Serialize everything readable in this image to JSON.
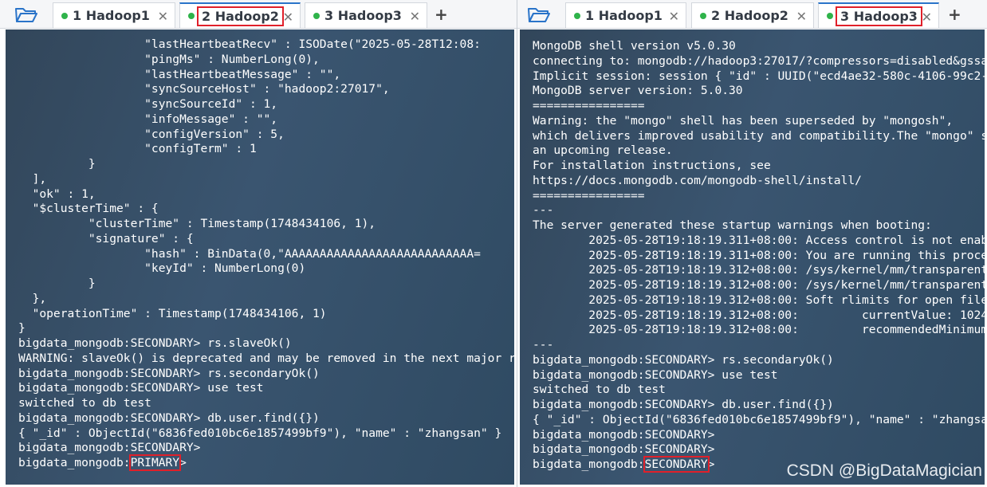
{
  "left": {
    "tabs": [
      {
        "label": "1 Hadoop1",
        "active": false,
        "highlighted": false
      },
      {
        "label": "2 Hadoop2",
        "active": true,
        "highlighted": true
      },
      {
        "label": "3 Hadoop3",
        "active": false,
        "highlighted": false
      }
    ],
    "lines": [
      "                  \"lastHeartbeatRecv\" : ISODate(\"2025-05-28T12:08:",
      "                  \"pingMs\" : NumberLong(0),",
      "                  \"lastHeartbeatMessage\" : \"\",",
      "                  \"syncSourceHost\" : \"hadoop2:27017\",",
      "                  \"syncSourceId\" : 1,",
      "                  \"infoMessage\" : \"\",",
      "                  \"configVersion\" : 5,",
      "                  \"configTerm\" : 1",
      "          }",
      "  ],",
      "  \"ok\" : 1,",
      "  \"$clusterTime\" : {",
      "          \"clusterTime\" : Timestamp(1748434106, 1),",
      "          \"signature\" : {",
      "                  \"hash\" : BinData(0,\"AAAAAAAAAAAAAAAAAAAAAAAAAAA=",
      "                  \"keyId\" : NumberLong(0)",
      "          }",
      "  },",
      "  \"operationTime\" : Timestamp(1748434106, 1)",
      "}",
      "bigdata_mongodb:SECONDARY> rs.slaveOk()",
      "WARNING: slaveOk() is deprecated and may be removed in the next major re",
      "bigdata_mongodb:SECONDARY> rs.secondaryOk()",
      "bigdata_mongodb:SECONDARY> use test",
      "switched to db test",
      "bigdata_mongodb:SECONDARY> db.user.find({})",
      "{ \"_id\" : ObjectId(\"6836fed010bc6e1857499bf9\"), \"name\" : \"zhangsan\" }",
      "bigdata_mongodb:SECONDARY>"
    ],
    "last_prefix": "bigdata_mongodb:",
    "last_state": "PRIMARY",
    "last_suffix": ">"
  },
  "right": {
    "tabs": [
      {
        "label": "1 Hadoop1",
        "active": false,
        "highlighted": false
      },
      {
        "label": "2 Hadoop2",
        "active": false,
        "highlighted": false
      },
      {
        "label": "3 Hadoop3",
        "active": true,
        "highlighted": true
      }
    ],
    "lines": [
      "MongoDB shell version v5.0.30",
      "connecting to: mongodb://hadoop3:27017/?compressors=disabled&gssap",
      "Implicit session: session { \"id\" : UUID(\"ecd4ae32-580c-4106-99c2-5",
      "MongoDB server version: 5.0.30",
      "================",
      "Warning: the \"mongo\" shell has been superseded by \"mongosh\",",
      "which delivers improved usability and compatibility.The \"mongo\" sh",
      "an upcoming release.",
      "For installation instructions, see",
      "https://docs.mongodb.com/mongodb-shell/install/",
      "================",
      "---",
      "The server generated these startup warnings when booting:",
      "        2025-05-28T19:18:19.311+08:00: Access control is not enabl",
      "        2025-05-28T19:18:19.311+08:00: You are running this proces",
      "        2025-05-28T19:18:19.312+08:00: /sys/kernel/mm/transparent_",
      "        2025-05-28T19:18:19.312+08:00: /sys/kernel/mm/transparent_",
      "        2025-05-28T19:18:19.312+08:00: Soft rlimits for open file",
      "        2025-05-28T19:18:19.312+08:00:         currentValue: 1024",
      "        2025-05-28T19:18:19.312+08:00:         recommendedMinimum",
      "---",
      "bigdata_mongodb:SECONDARY> rs.secondaryOk()",
      "bigdata_mongodb:SECONDARY> use test",
      "switched to db test",
      "bigdata_mongodb:SECONDARY> db.user.find({})",
      "{ \"_id\" : ObjectId(\"6836fed010bc6e1857499bf9\"), \"name\" : \"zhangsan",
      "bigdata_mongodb:SECONDARY>",
      "bigdata_mongodb:SECONDARY>"
    ],
    "last_prefix": "bigdata_mongodb:",
    "last_state": "SECONDARY",
    "last_suffix": ">"
  },
  "watermark": "CSDN @BigDataMagician",
  "colors": {
    "highlight": "#e0202a",
    "tab_dot": "#2fb34a",
    "terminal_bg": "#3a5570"
  }
}
